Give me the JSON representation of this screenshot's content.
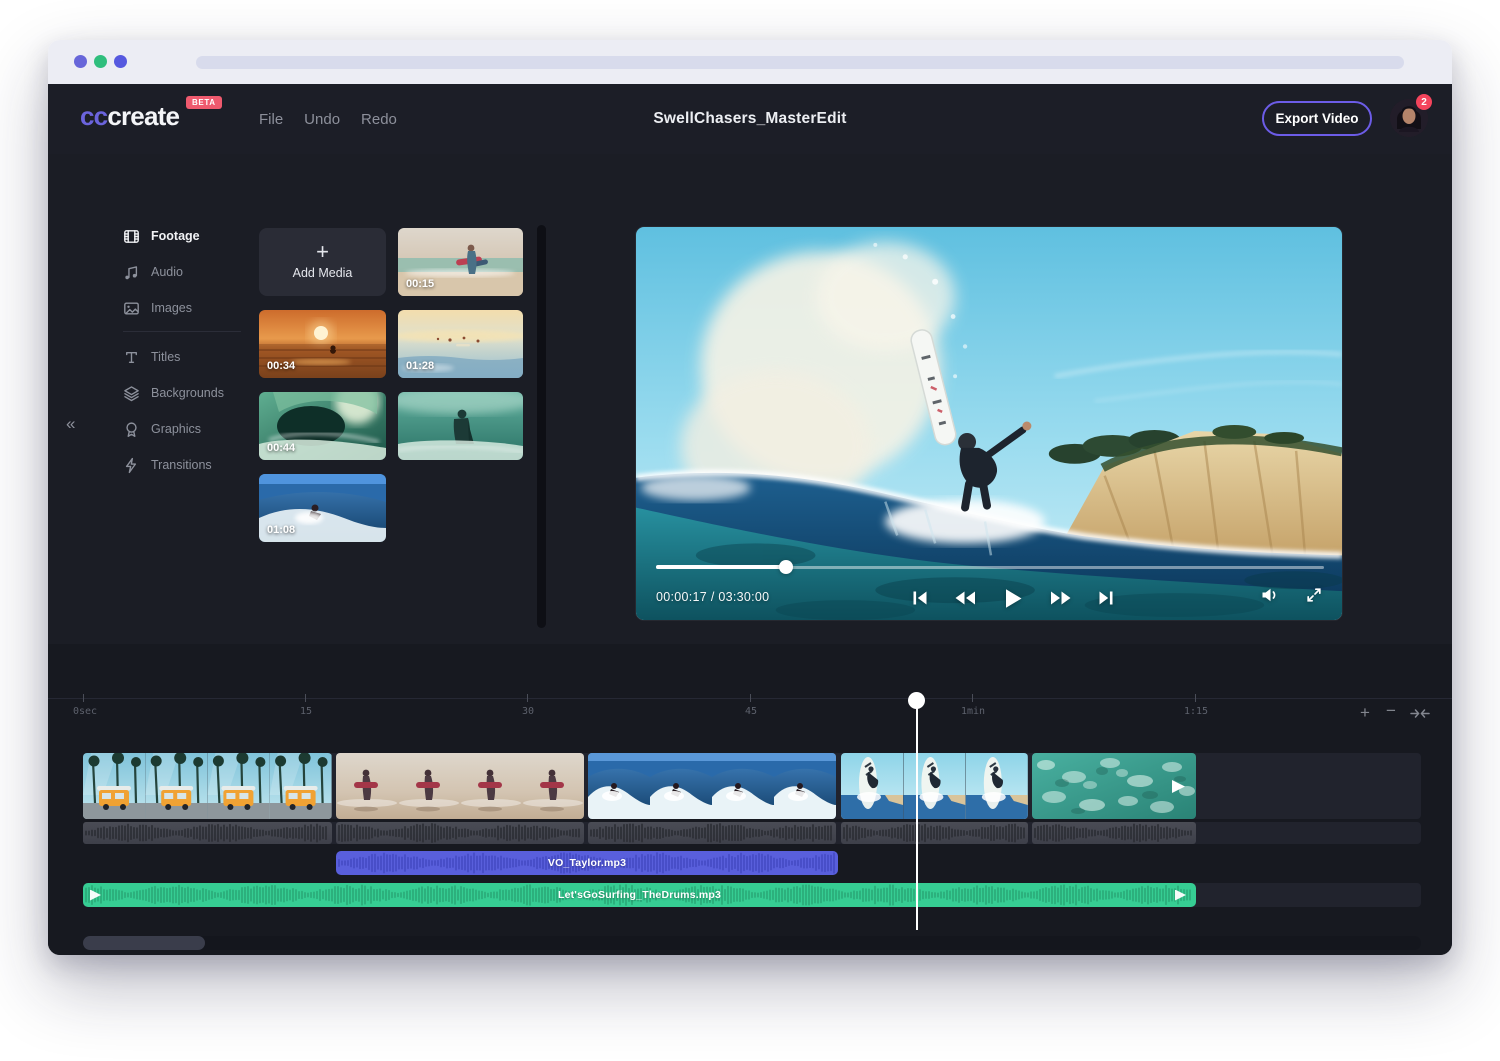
{
  "colors": {
    "accent_purple": "#6c5ce7",
    "beta_red": "#ef5a6e",
    "notification_red": "#f4445c",
    "vo_clip_blue": "#595fdc",
    "music_clip_green": "#36cd93",
    "app_background": "#1b1d25"
  },
  "header": {
    "logo_prefix": "cc",
    "logo_suffix": "create",
    "beta_label": "BETA",
    "menu": [
      {
        "label": "File"
      },
      {
        "label": "Undo"
      },
      {
        "label": "Redo"
      }
    ],
    "project_title": "SwellChasers_MasterEdit",
    "export_label": "Export Video",
    "notification_count": "2"
  },
  "sidebar": {
    "collapse_icon": "«",
    "items": [
      {
        "label": "Footage",
        "icon": "film-icon",
        "active": true
      },
      {
        "label": "Audio",
        "icon": "music-note-icon",
        "active": false
      },
      {
        "label": "Images",
        "icon": "image-icon",
        "active": false
      },
      {
        "label": "Titles",
        "icon": "text-icon",
        "active": false
      },
      {
        "label": "Backgrounds",
        "icon": "layers-icon",
        "active": false
      },
      {
        "label": "Graphics",
        "icon": "badge-icon",
        "active": false
      },
      {
        "label": "Transitions",
        "icon": "lightning-icon",
        "active": false
      }
    ]
  },
  "media_library": {
    "add_media_label": "Add Media",
    "clips": [
      {
        "duration": "00:15"
      },
      {
        "duration": "00:34"
      },
      {
        "duration": "01:28"
      },
      {
        "duration": "00:44"
      },
      {
        "duration": ""
      },
      {
        "duration": "01:08"
      }
    ]
  },
  "player": {
    "time_display": "00:00:17 / 03:30:00",
    "current_time": "00:00:17",
    "total_duration": "03:30:00",
    "progress_percent": 19.5
  },
  "timeline": {
    "ruler_ticks": [
      "0sec",
      "15",
      "30",
      "45",
      "1min",
      "1:15"
    ],
    "zoom_in_label": "+",
    "zoom_out_label": "−",
    "voiceover_clip": {
      "name": "VO_Taylor.mp3"
    },
    "music_clip": {
      "name": "Let'sGoSurfing_TheDrums.mp3"
    }
  }
}
